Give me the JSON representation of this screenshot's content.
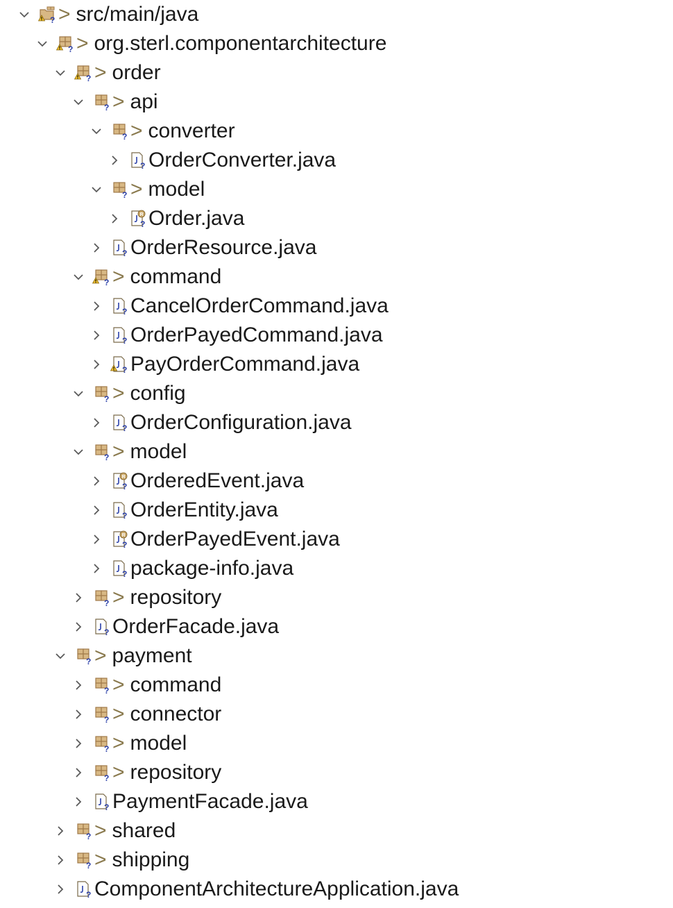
{
  "tree": [
    {
      "depth": 0,
      "type": "folder",
      "expanded": true,
      "warn": true,
      "label": "src/main/java"
    },
    {
      "depth": 1,
      "type": "package",
      "expanded": true,
      "warn": true,
      "label": "org.sterl.componentarchitecture"
    },
    {
      "depth": 2,
      "type": "package",
      "expanded": true,
      "warn": true,
      "label": "order"
    },
    {
      "depth": 3,
      "type": "package",
      "expanded": true,
      "warn": false,
      "label": "api"
    },
    {
      "depth": 4,
      "type": "package",
      "expanded": true,
      "warn": false,
      "label": "converter"
    },
    {
      "depth": 5,
      "type": "file",
      "expanded": false,
      "warn": false,
      "record": false,
      "label": "OrderConverter.java"
    },
    {
      "depth": 4,
      "type": "package",
      "expanded": true,
      "warn": false,
      "label": "model"
    },
    {
      "depth": 5,
      "type": "file",
      "expanded": false,
      "warn": false,
      "record": true,
      "label": "Order.java"
    },
    {
      "depth": 4,
      "type": "file",
      "expanded": false,
      "warn": false,
      "record": false,
      "label": "OrderResource.java"
    },
    {
      "depth": 3,
      "type": "package",
      "expanded": true,
      "warn": true,
      "label": "command"
    },
    {
      "depth": 4,
      "type": "file",
      "expanded": false,
      "warn": false,
      "record": false,
      "label": "CancelOrderCommand.java"
    },
    {
      "depth": 4,
      "type": "file",
      "expanded": false,
      "warn": false,
      "record": false,
      "label": "OrderPayedCommand.java"
    },
    {
      "depth": 4,
      "type": "file",
      "expanded": false,
      "warn": true,
      "record": false,
      "label": "PayOrderCommand.java"
    },
    {
      "depth": 3,
      "type": "package",
      "expanded": true,
      "warn": false,
      "label": "config"
    },
    {
      "depth": 4,
      "type": "file",
      "expanded": false,
      "warn": false,
      "record": false,
      "label": "OrderConfiguration.java"
    },
    {
      "depth": 3,
      "type": "package",
      "expanded": true,
      "warn": false,
      "label": "model"
    },
    {
      "depth": 4,
      "type": "file",
      "expanded": false,
      "warn": false,
      "record": true,
      "label": "OrderedEvent.java"
    },
    {
      "depth": 4,
      "type": "file",
      "expanded": false,
      "warn": false,
      "record": false,
      "label": "OrderEntity.java"
    },
    {
      "depth": 4,
      "type": "file",
      "expanded": false,
      "warn": false,
      "record": true,
      "label": "OrderPayedEvent.java"
    },
    {
      "depth": 4,
      "type": "file",
      "expanded": false,
      "warn": false,
      "record": false,
      "label": "package-info.java"
    },
    {
      "depth": 3,
      "type": "package",
      "expanded": false,
      "warn": false,
      "label": "repository"
    },
    {
      "depth": 3,
      "type": "file",
      "expanded": false,
      "warn": false,
      "record": false,
      "label": "OrderFacade.java"
    },
    {
      "depth": 2,
      "type": "package",
      "expanded": true,
      "warn": false,
      "label": "payment"
    },
    {
      "depth": 3,
      "type": "package",
      "expanded": false,
      "warn": false,
      "label": "command"
    },
    {
      "depth": 3,
      "type": "package",
      "expanded": false,
      "warn": false,
      "label": "connector"
    },
    {
      "depth": 3,
      "type": "package",
      "expanded": false,
      "warn": false,
      "label": "model"
    },
    {
      "depth": 3,
      "type": "package",
      "expanded": false,
      "warn": false,
      "label": "repository"
    },
    {
      "depth": 3,
      "type": "file",
      "expanded": false,
      "warn": false,
      "record": false,
      "label": "PaymentFacade.java"
    },
    {
      "depth": 2,
      "type": "package",
      "expanded": false,
      "warn": false,
      "label": "shared"
    },
    {
      "depth": 2,
      "type": "package",
      "expanded": false,
      "warn": false,
      "label": "shipping"
    },
    {
      "depth": 2,
      "type": "file",
      "expanded": false,
      "warn": false,
      "record": false,
      "label": "ComponentArchitectureApplication.java"
    }
  ],
  "tree_decoration": ">",
  "colors": {
    "package_brown": "#a07a4a",
    "package_light": "#d8b884",
    "question_blue": "#2a3fa8",
    "warning_yellow": "#f2c230",
    "chevron_gray": "#5a5a5a",
    "file_outline": "#7a6a4a"
  }
}
